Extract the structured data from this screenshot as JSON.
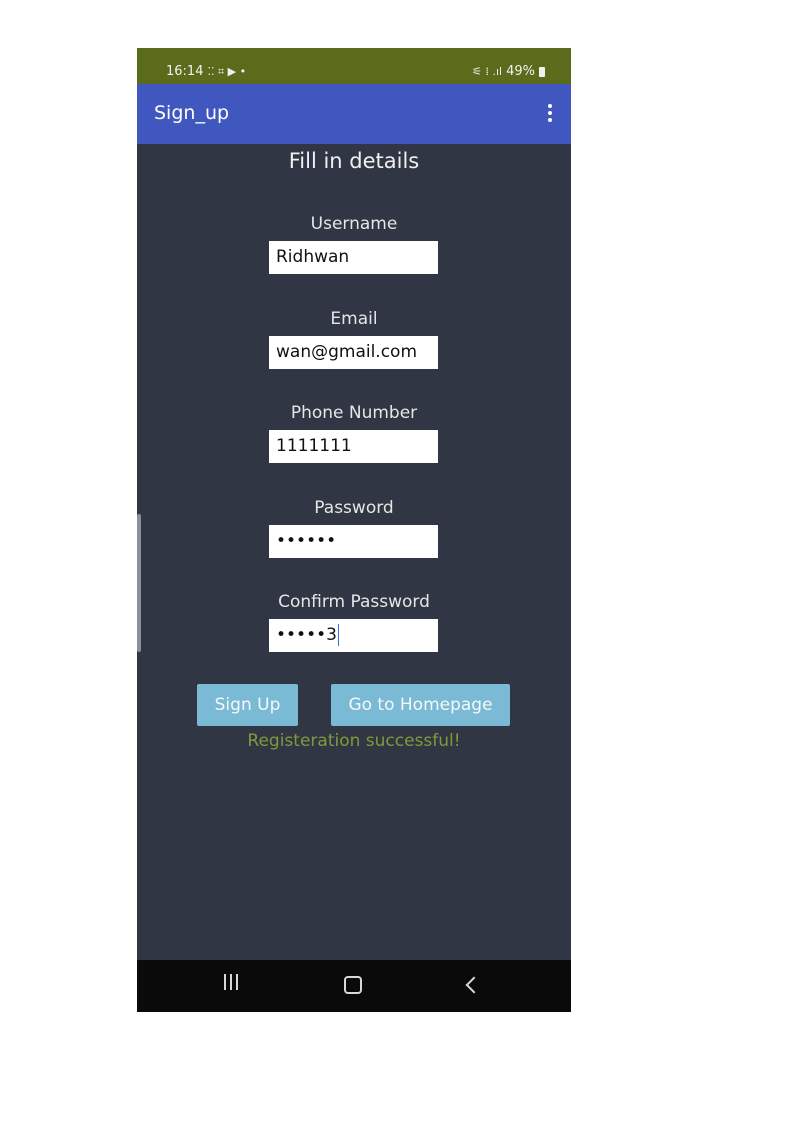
{
  "status_bar": {
    "time": "16:14",
    "left_glyphs": "⁚⁚ ⌗ ▶ •",
    "right_glyphs": "⚟ ⁞ .ıl",
    "battery": "49%"
  },
  "app_bar": {
    "title": "Sign_up",
    "menu_icon": "more-vert-icon"
  },
  "form": {
    "heading": "Fill in details",
    "fields": [
      {
        "label": "Username",
        "value": "Ridhwan"
      },
      {
        "label": "Email",
        "value": "wan@gmail.com"
      },
      {
        "label": "Phone Number",
        "value": "1111111"
      },
      {
        "label": "Password",
        "value": "••••••"
      },
      {
        "label": "Confirm Password",
        "value": "•••••3"
      }
    ],
    "sign_up_label": "Sign Up",
    "homepage_label": "Go to Homepage",
    "status_message": "Registeration successful!"
  },
  "colors": {
    "app_bar": "#4057c0",
    "background": "#303644",
    "status_bar": "#5a6b1c",
    "button": "#7bbad4",
    "success_text": "#7f9a3a"
  },
  "nav_bar": {
    "icons": [
      "recents-icon",
      "home-icon",
      "back-icon"
    ]
  }
}
